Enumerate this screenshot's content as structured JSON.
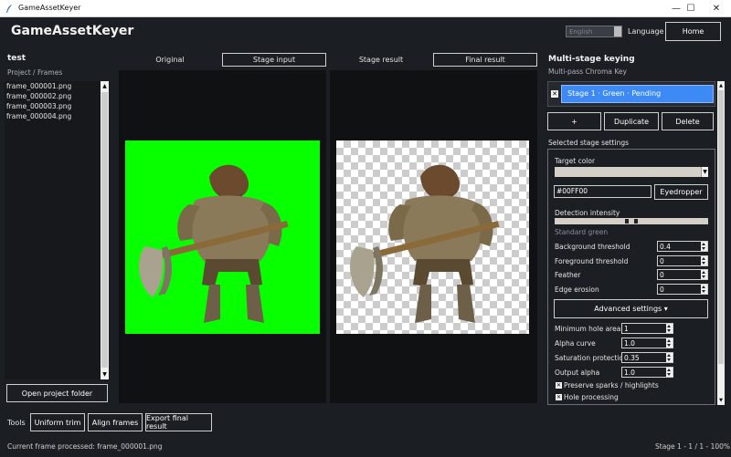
{
  "window": {
    "title": "GameAssetKeyer",
    "minimize": "—",
    "maximize": "☐",
    "close": "✕"
  },
  "header": {
    "title": "GameAssetKeyer",
    "language_value": "English",
    "language_label": "Language",
    "home_label": "Home"
  },
  "project": {
    "name": "test",
    "breadcrumb": "Project / Frames",
    "files": [
      "frame_000001.png",
      "frame_000002.png",
      "frame_000003.png",
      "frame_000004.png"
    ],
    "open_folder_label": "Open project folder"
  },
  "tabs": {
    "original": "Original",
    "stage_input": "Stage input",
    "stage_result": "Stage result",
    "final_result": "Final result"
  },
  "keying": {
    "title": "Multi-stage keying",
    "subtitle": "Multi-pass Chroma Key",
    "stage_label": "Stage 1 · Green  · Pending",
    "add_label": "+",
    "duplicate_label": "Duplicate",
    "delete_label": "Delete",
    "settings_title": "Selected stage settings",
    "target_color_label": "Target color",
    "hex_value": "#00FF00",
    "eyedropper_label": "Eyedropper",
    "detection_label": "Detection intensity",
    "detection_value": "Standard green",
    "params": [
      {
        "label": "Background threshold",
        "value": "0.4"
      },
      {
        "label": "Foreground threshold",
        "value": "0"
      },
      {
        "label": "Feather",
        "value": "0"
      },
      {
        "label": "Edge erosion",
        "value": "0"
      }
    ],
    "advanced_label": "Advanced settings ▾",
    "advanced": [
      {
        "label": "Minimum hole area",
        "value": "1"
      },
      {
        "label": "Alpha curve",
        "value": "1.0"
      },
      {
        "label": "Saturation protection",
        "value": "0.35"
      },
      {
        "label": "Output alpha",
        "value": "1.0"
      }
    ],
    "checks": [
      {
        "label": "Preserve sparks / highlights",
        "checked": true
      },
      {
        "label": "Hole processing",
        "checked": true
      }
    ]
  },
  "toolbar": {
    "tools_label": "Tools",
    "uniform_trim": "Uniform trim",
    "align_frames": "Align frames",
    "export_final": "Export final result"
  },
  "status": {
    "left": "Current frame processed: frame_000001.png",
    "right": "Stage 1 - 1 / 1 - 100%"
  },
  "colors": {
    "accent": "#3d8af7",
    "key_green": "#08ff00",
    "background": "#1b1e22"
  }
}
